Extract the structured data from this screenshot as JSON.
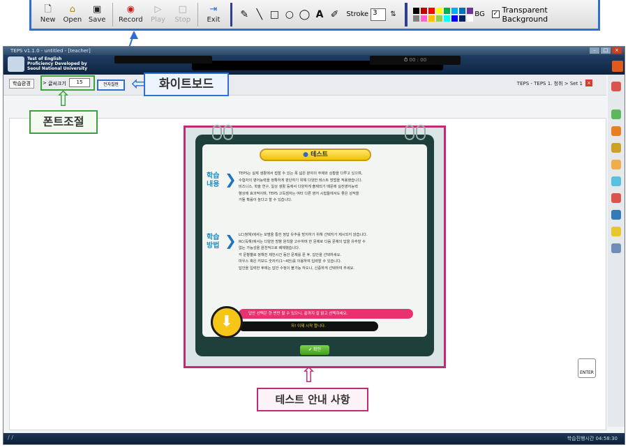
{
  "toolbar": {
    "buttons": [
      {
        "label": "New",
        "icon": "new-file-icon"
      },
      {
        "label": "Open",
        "icon": "open-folder-icon"
      },
      {
        "label": "Save",
        "icon": "save-disk-icon"
      },
      {
        "label": "Record",
        "icon": "record-icon"
      },
      {
        "label": "Play",
        "icon": "play-icon"
      },
      {
        "label": "Stop",
        "icon": "stop-icon"
      },
      {
        "label": "Exit",
        "icon": "exit-icon"
      }
    ],
    "tools": [
      "pen-icon",
      "line-icon",
      "rectangle-icon",
      "circle-icon",
      "ellipse-icon",
      "text-icon",
      "eraser-icon"
    ],
    "text_tool_label": "A",
    "stroke_label": "Stroke",
    "stroke_value": "3",
    "bg_label": "BG",
    "transparent_label": "Transparent Background",
    "transparent_checked": true,
    "palette": [
      "#000000",
      "#c00000",
      "#ff0000",
      "#ffff00",
      "#00b050",
      "#00b0f0",
      "#0070c0",
      "#7030a0",
      "#808080",
      "#ff66cc",
      "#ffc000",
      "#92d050",
      "#00ffff",
      "#0000ff",
      "#002060",
      "#ffffff"
    ]
  },
  "app": {
    "window_title": "TEPS v1.1.0 - untitled - [teacher]",
    "logo_lines": [
      "Test of English",
      "Proficiency Developed by",
      "Seoul National University"
    ],
    "subbar": {
      "study_btn": "학습환경",
      "font_label": "글씨크기",
      "font_size": "15",
      "whiteboard_btn": "전자칠판"
    },
    "breadcrumb": "TEPS - TEPS 1. 청취 > Set 1",
    "timer": "00 : 00",
    "status_left": "/ /",
    "status_right": "학습진행시간 04:58:30",
    "enter_label": "ENTER"
  },
  "guide": {
    "title": "테스트",
    "section1_label": [
      "학습",
      "내용"
    ],
    "section1_lines": [
      "TEPS는 실제 생활에서 접할 수 있는 폭 넓은 분야의 주제와 상황을 다루고 있으며,",
      "수험자의 영어능력을 정확하게 판단하기 위해 다양한 테스트 방법을 적용했습니다.",
      "비즈니스, 학술 연구, 일상 생활 등에서 다양하게 출제되기 때문에 실전영어능력",
      "향상에 효과적이며, TEPS 고득점자는 여타 다른 영어 시험들에서도 좋은 성적을",
      "거둘 확률이 높다고 할 수 있습니다."
    ],
    "section2_label": [
      "학습",
      "방법"
    ],
    "section2_lines": [
      "LC(청해)에서는 모범을 통한 정답 유추를 방지하기 위해 선택지가 제시되지 않습니다.",
      "RC(독해)에서는 다양한 방향 원칙을 고수하며 한 문제로 다음 문제의 답을 유추할 수",
      "없는 가능성을 원천적으로 배제했습니다.",
      "각 문항별로 정해진 제한시간 동안 문제를 푼 후, 답안을 선택하세요.",
      "마우스 혹은 키보드 숫자키(1~4번)를 이용하여 입력할 수 있습니다.",
      "답안을 입력한 후에는 답안 수정이 불가능 하오니, 신중하게 선택하여 주세요."
    ],
    "alert_pink": "답안 선택은 한 번만 할 수 있으니, 끝까지 잘 읽고 선택하세요.",
    "alert_black": "자! 이제 시작 합니다.",
    "start_label": "확인"
  },
  "callouts": {
    "font": "폰트조절",
    "whiteboard": "화이트보드",
    "guide": "테스트 안내 사항"
  }
}
